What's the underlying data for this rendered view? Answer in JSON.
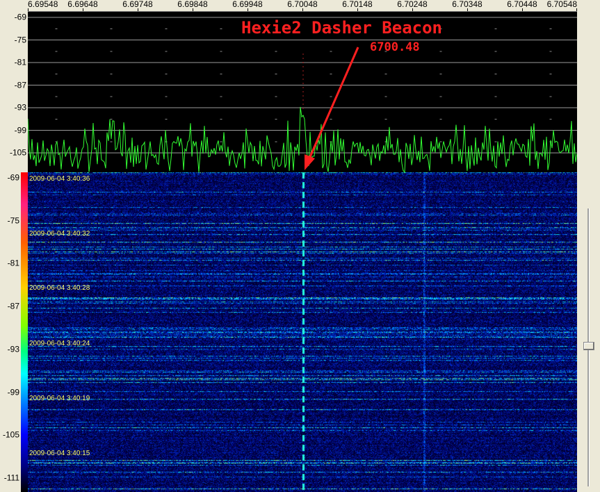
{
  "frequency_ruler": {
    "ticks": [
      "6.69548",
      "6.69648",
      "6.69748",
      "6.69848",
      "6.69948",
      "6.70048",
      "6.70148",
      "6.70248",
      "6.70348",
      "6.70448",
      "6.70548"
    ]
  },
  "spectrum": {
    "db_labels": [
      "-69",
      "-75",
      "-81",
      "-87",
      "-93",
      "-99",
      "-105"
    ],
    "trace_color": "#33ff33"
  },
  "waterfall": {
    "db_labels": [
      "-69",
      "-75",
      "-81",
      "-87",
      "-93",
      "-99",
      "-105",
      "-111"
    ],
    "timestamps": [
      "2009-06-04 3:40:36",
      "2009-06-04 3:40:32",
      "2009-06-04 3:40:28",
      "2009-06-04 3:40:24",
      "2009-06-04 3:40:19",
      "2009-06-04 3:40:15"
    ],
    "timestamp_color": "#ffff66"
  },
  "annotation": {
    "title": "Hexie2 Dasher Beacon",
    "frequency": "6700.48",
    "color": "#ff2020"
  },
  "slider": {
    "level": 0.48
  }
}
